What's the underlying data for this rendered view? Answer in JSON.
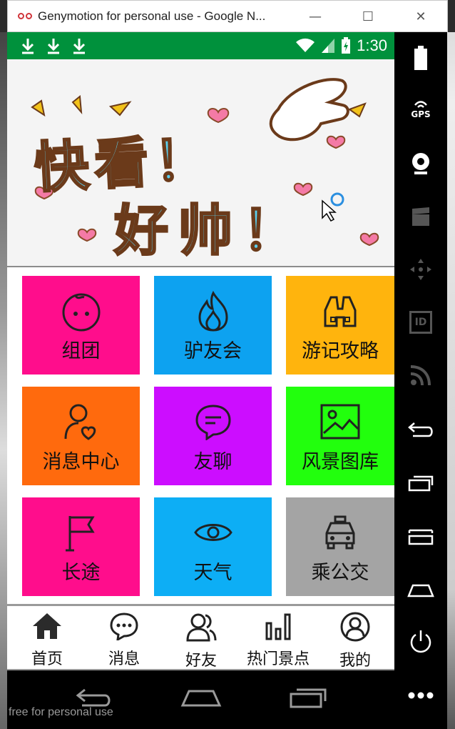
{
  "window": {
    "title": "Genymotion for personal use - Google N...",
    "minimize_label": "—",
    "maximize_label": "☐",
    "close_label": "✕"
  },
  "statusbar": {
    "time": "1:30"
  },
  "banner": {
    "line1": "快看！",
    "line2": "好帅！"
  },
  "grid": [
    {
      "label": "组团",
      "color": "#ff0d8c",
      "icon": "face-icon"
    },
    {
      "label": "驴友会",
      "color": "#0da2f0",
      "icon": "fire-icon"
    },
    {
      "label": "游记攻略",
      "color": "#ffb40d",
      "icon": "binoculars-icon"
    },
    {
      "label": "消息中心",
      "color": "#ff6a0d",
      "icon": "user-heart-icon"
    },
    {
      "label": "友聊",
      "color": "#cc0dff",
      "icon": "chat-bubble-icon"
    },
    {
      "label": "风景图库",
      "color": "#22ff0d",
      "icon": "picture-icon"
    },
    {
      "label": "长途",
      "color": "#ff0d8c",
      "icon": "flag-icon"
    },
    {
      "label": "天气",
      "color": "#0daef5",
      "icon": "eye-icon"
    },
    {
      "label": "乘公交",
      "color": "#a4a4a4",
      "icon": "taxi-icon"
    }
  ],
  "bottom_nav": [
    {
      "label": "首页",
      "icon": "home-icon"
    },
    {
      "label": "消息",
      "icon": "message-icon"
    },
    {
      "label": "好友",
      "icon": "friends-icon"
    },
    {
      "label": "热门景点",
      "icon": "bar-chart-icon"
    },
    {
      "label": "我的",
      "icon": "profile-icon"
    }
  ],
  "sidebar": {
    "gps_label": "GPS",
    "id_label": "ID"
  },
  "watermark": "free for personal use"
}
